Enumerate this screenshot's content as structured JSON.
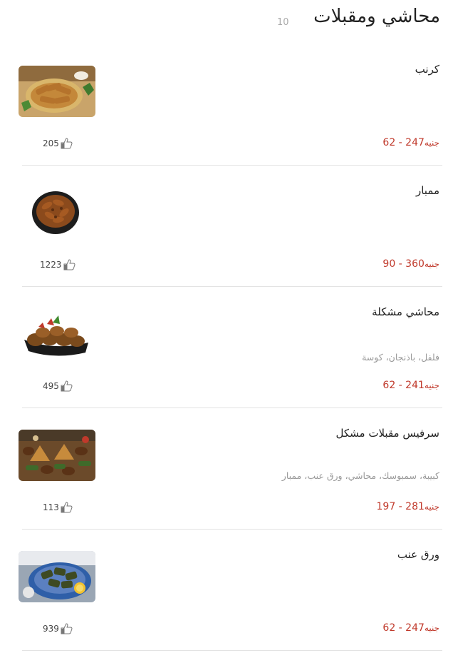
{
  "header": {
    "title": "محاشي ومقبلات",
    "count": "10"
  },
  "items": [
    {
      "name": "كرنب",
      "description": "",
      "price_range": "62 - 247",
      "currency": "جنيه",
      "likes": "205",
      "image_icon": "stuffed-cabbage-image"
    },
    {
      "name": "ممبار",
      "description": "",
      "price_range": "90 - 360",
      "currency": "جنيه",
      "likes": "1223",
      "image_icon": "mombar-image"
    },
    {
      "name": "محاشي مشكلة",
      "description": "فلفل، باذنجان، كوسة",
      "price_range": "62 - 241",
      "currency": "جنيه",
      "likes": "495",
      "image_icon": "mixed-stuffed-vegetables-image"
    },
    {
      "name": "سرفيس مقبلات مشكل",
      "description": "كبيبة، سمبوسك، محاشي، ورق عنب، ممبار",
      "price_range": "197 - 281",
      "currency": "جنيه",
      "likes": "113",
      "image_icon": "mixed-appetizers-platter-image"
    },
    {
      "name": "ورق عنب",
      "description": "",
      "price_range": "62 - 247",
      "currency": "جنيه",
      "likes": "939",
      "image_icon": "grape-leaves-image"
    }
  ],
  "colors": {
    "price": "#c0392b",
    "muted": "#9a9a9a",
    "divider": "#e3e3e3"
  }
}
